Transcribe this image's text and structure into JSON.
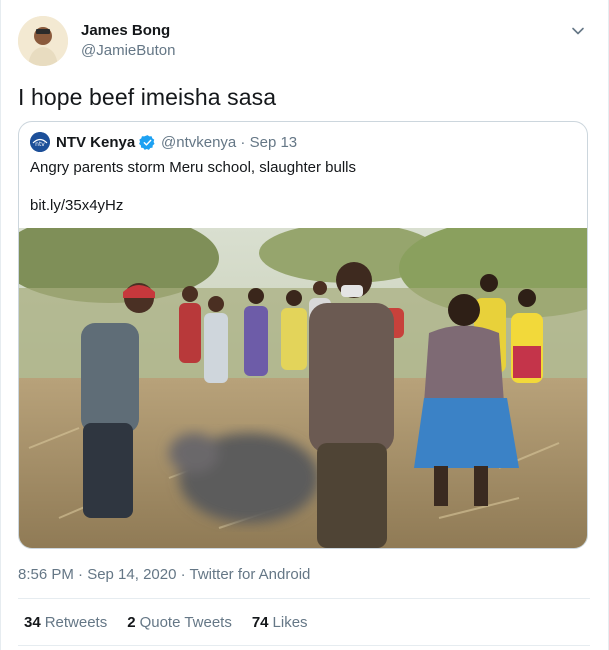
{
  "tweet": {
    "display_name": "James Bong",
    "handle": "@JamieButon",
    "text": "I hope beef imeisha sasa",
    "timestamp": "8:56 PM · Sep 14, 2020 · Twitter for Android"
  },
  "quote": {
    "display_name": "NTV Kenya",
    "meta": "@ntvkenya · Sep 13",
    "text": "Angry parents storm Meru school, slaughter bulls",
    "link": "bit.ly/35x4yHz",
    "avatar_text": "ntv"
  },
  "stats": [
    {
      "count": "34",
      "label": "Retweets"
    },
    {
      "count": "2",
      "label": "Quote Tweets"
    },
    {
      "count": "74",
      "label": "Likes"
    }
  ],
  "colors": {
    "text": "#14171a",
    "secondary": "#657786",
    "border": "#ccd6dd",
    "verified": "#1da1f2"
  },
  "icons": {
    "caret": "chevron-down-icon",
    "verified": "verified-badge-icon"
  }
}
